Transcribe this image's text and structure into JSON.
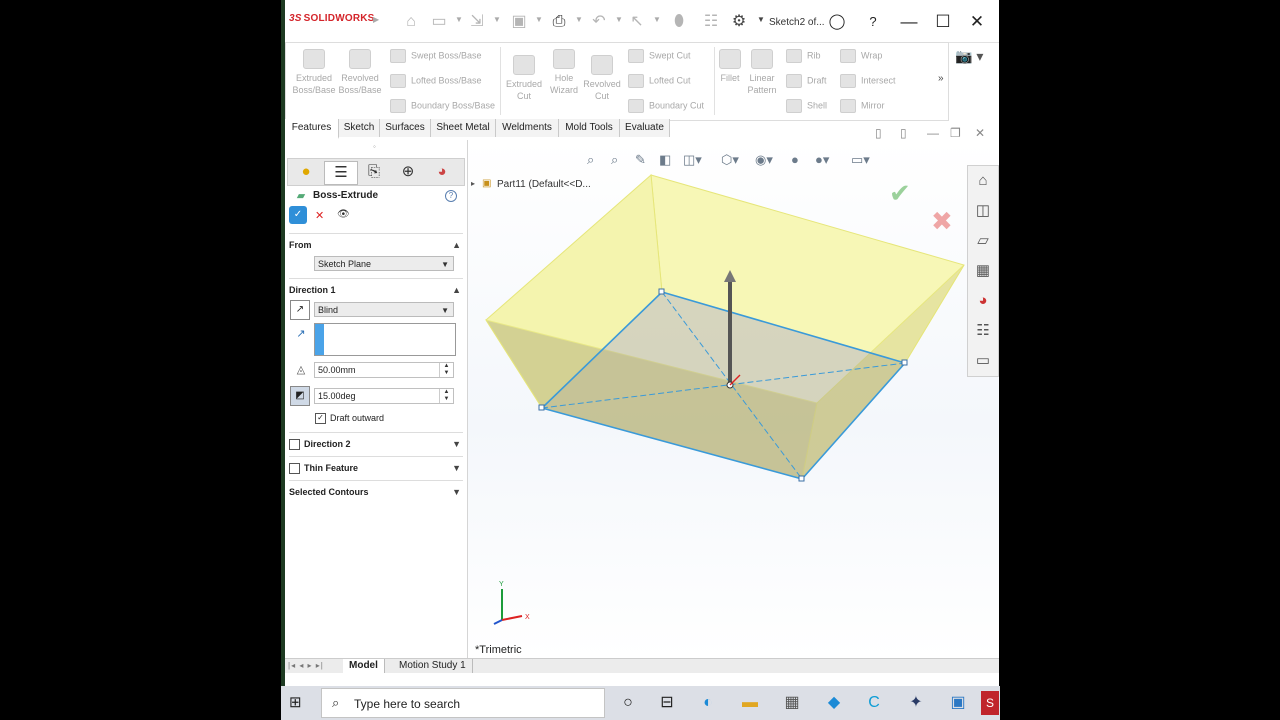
{
  "titlebar": {
    "logo_mark": "3S",
    "logo_text": "SOLIDWORKS",
    "document": "Sketch2 of...",
    "icons": [
      "home-icon",
      "new-document-icon",
      "open-icon",
      "save-icon",
      "print-icon",
      "undo-icon",
      "select-icon",
      "rebuild-icon",
      "file-properties-icon",
      "options-gear-icon"
    ],
    "window_buttons": [
      "user-icon",
      "help-icon",
      "minimize-icon",
      "maximize-icon",
      "close-icon"
    ]
  },
  "ribbon": {
    "large_tools": [
      {
        "label": "Extruded Boss/Base"
      },
      {
        "label": "Revolved Boss/Base"
      },
      {
        "label": "Extruded Cut"
      },
      {
        "label": "Hole Wizard"
      },
      {
        "label": "Revolved Cut"
      },
      {
        "label": "Fillet"
      },
      {
        "label": "Linear Pattern"
      }
    ],
    "small_tools": [
      {
        "label": "Swept Boss/Base"
      },
      {
        "label": "Lofted Boss/Base"
      },
      {
        "label": "Boundary Boss/Base"
      },
      {
        "label": "Swept Cut"
      },
      {
        "label": "Lofted Cut"
      },
      {
        "label": "Boundary Cut"
      },
      {
        "label": "Rib"
      },
      {
        "label": "Draft"
      },
      {
        "label": "Shell"
      },
      {
        "label": "Wrap"
      },
      {
        "label": "Intersect"
      },
      {
        "label": "Mirror"
      }
    ],
    "more": "»"
  },
  "tabs": [
    "Features",
    "Sketch",
    "Surfaces",
    "Sheet Metal",
    "Weldments",
    "Mold Tools",
    "Evaluate"
  ],
  "active_tab": "Features",
  "property_manager": {
    "title": "Boss-Extrude",
    "help": "?",
    "from": {
      "label": "From",
      "value": "Sketch Plane"
    },
    "direction1": {
      "label": "Direction 1",
      "end_condition": "Blind",
      "depth": "50.00mm",
      "draft_angle": "15.00deg",
      "draft_outward_label": "Draft outward",
      "draft_outward_checked": true
    },
    "direction2": {
      "label": "Direction 2",
      "checked": false
    },
    "thin_feature": {
      "label": "Thin Feature",
      "checked": false
    },
    "selected_contours": {
      "label": "Selected Contours"
    }
  },
  "viewport": {
    "tree_item": "Part11  (Default<<D...",
    "view_label": "*Trimetric",
    "triad": {
      "x": "X",
      "y": "Y"
    },
    "accent_preview": "#f5f5a8",
    "sketch_color": "#3a9ad9"
  },
  "bottom_tabs": [
    "Model",
    "Motion Study 1"
  ],
  "active_bottom_tab": "Model",
  "taskbar": {
    "search_placeholder": "Type here to search",
    "icons": [
      "task-view-icon",
      "edge-icon",
      "file-explorer-icon",
      "calculator-icon",
      "paint-icon",
      "app-c-icon",
      "app-arrow-icon",
      "photos-icon",
      "solidworks-icon"
    ]
  }
}
